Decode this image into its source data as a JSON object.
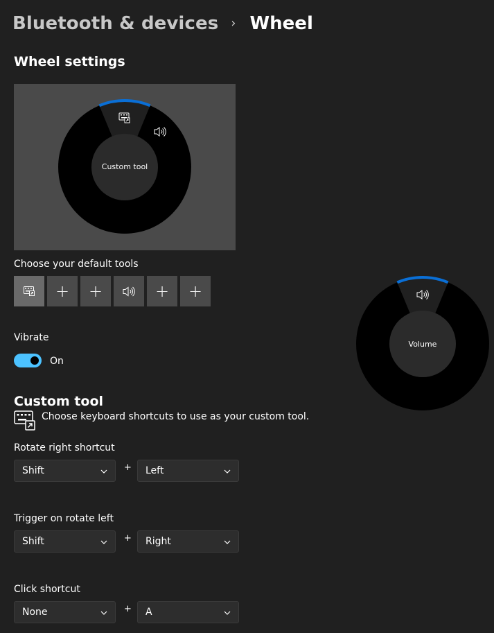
{
  "breadcrumb": {
    "parent": "Bluetooth & devices",
    "separator": "›",
    "current": "Wheel"
  },
  "wheel_settings": {
    "title": "Wheel settings",
    "preview": {
      "center_label": "Custom tool",
      "segment_icons": [
        "keyboard-shortcut-icon",
        "volume-icon"
      ]
    },
    "default_tools_label": "Choose your default tools",
    "tools": [
      {
        "icon": "keyboard-shortcut-icon",
        "label": ""
      },
      {
        "icon": "plus-icon",
        "label": "+"
      },
      {
        "icon": "plus-icon",
        "label": "+"
      },
      {
        "icon": "volume-icon",
        "label": ""
      },
      {
        "icon": "plus-icon",
        "label": "+"
      },
      {
        "icon": "plus-icon",
        "label": "+"
      }
    ]
  },
  "vibrate": {
    "label": "Vibrate",
    "state": "On"
  },
  "custom_tool": {
    "title": "Custom tool",
    "description": "Choose keyboard shortcuts to use as your custom tool.",
    "shortcuts": [
      {
        "label": "Rotate right shortcut",
        "modifier": "Shift",
        "plus": "+",
        "key": "Left"
      },
      {
        "label": "Trigger on rotate left",
        "modifier": "Shift",
        "plus": "+",
        "key": "Right"
      },
      {
        "label": "Click shortcut",
        "modifier": "None",
        "plus": "+",
        "key": "A"
      }
    ]
  },
  "volume_wheel": {
    "center_label": "Volume",
    "icon": "volume-icon"
  },
  "colors": {
    "accent": "#4cc2ff",
    "wheel_highlight": "#0a6fd6",
    "background": "#202020",
    "card": "#4a4a4a"
  }
}
